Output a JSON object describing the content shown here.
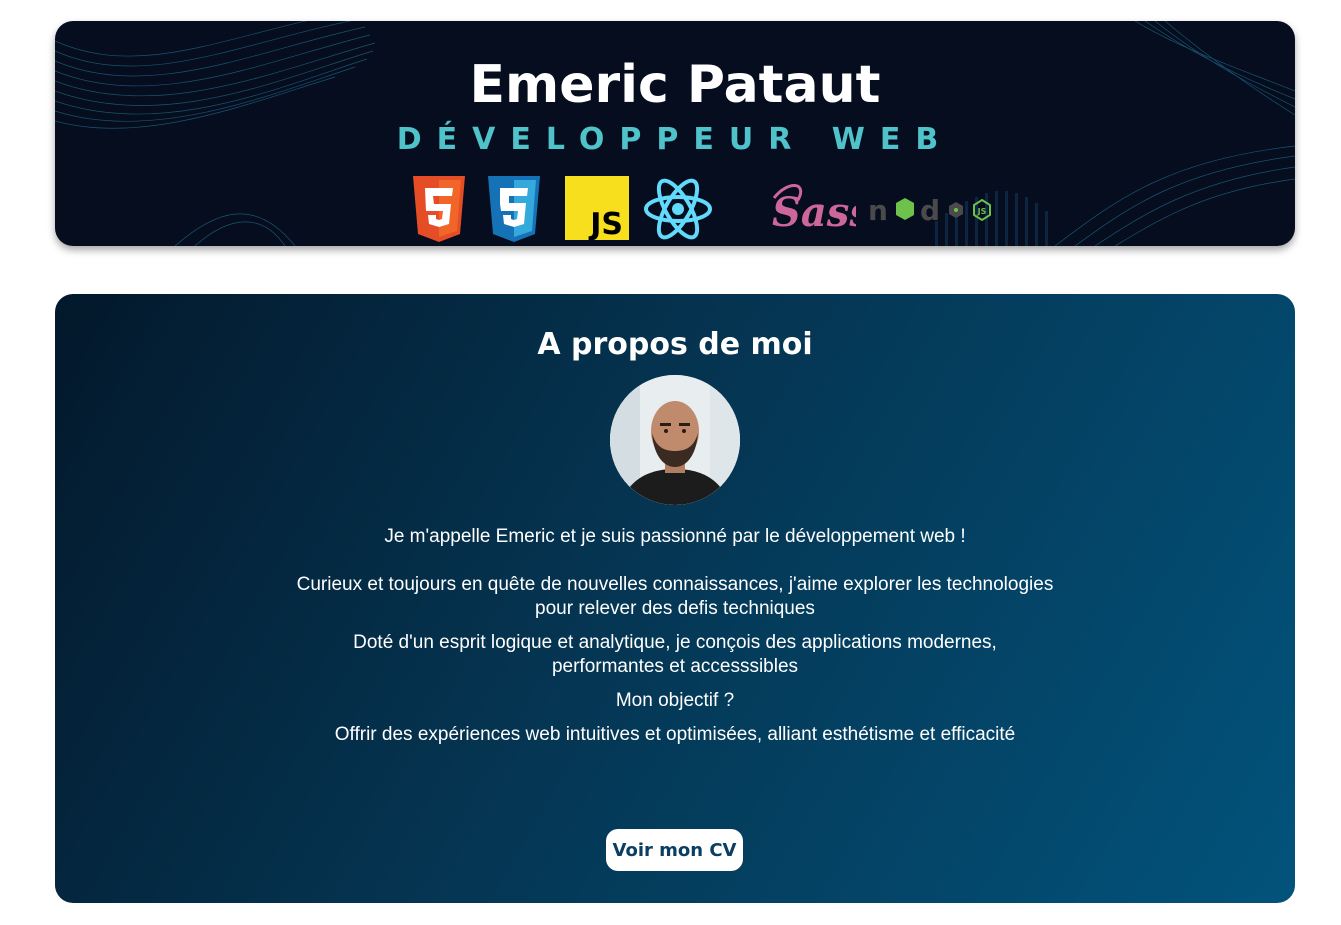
{
  "banner": {
    "name": "Emeric Pataut",
    "subtitle": "DÉVELOPPEUR WEB",
    "logos": [
      {
        "icon": "html5-icon",
        "label": "5",
        "color": "#e44d26"
      },
      {
        "icon": "css3-icon",
        "label": "3",
        "color": "#1572b6"
      },
      {
        "icon": "javascript-icon",
        "label": "JS",
        "color": "#f0db4f"
      },
      {
        "icon": "react-icon",
        "color": "#61dafb"
      },
      {
        "icon": "sass-icon",
        "label": "Sass",
        "color": "#cd6799"
      },
      {
        "icon": "nodejs-icon",
        "label": "node",
        "badge": "JS",
        "color": "#6cc24a"
      }
    ]
  },
  "about": {
    "title": "A propos de moi",
    "paragraphs": [
      "Je m'appelle Emeric et je suis passionné par le développement web !",
      "Curieux et toujours en quête de nouvelles connaissances, j'aime explorer les technologies pour relever des defis techniques",
      "Doté d'un esprit logique et analytique, je conçois des applications modernes, performantes et accesssibles",
      "Mon objectif ?",
      "Offrir des expériences web intuitives et optimisées, alliant esthétisme et efficacité"
    ],
    "cv_button": "Voir mon CV"
  },
  "colors": {
    "accent": "#4fc3c9",
    "banner_bg": "#050d1f",
    "button_text": "#0b3e63"
  }
}
